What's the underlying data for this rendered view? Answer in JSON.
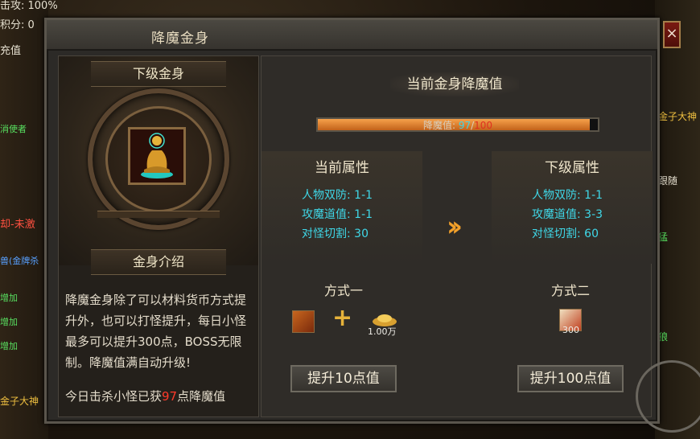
{
  "background": {
    "left_texts": [
      "击攻: 100%",
      "积分: 0",
      "充值",
      "消使者",
      "却-未激",
      "兽(金牌杀",
      "增加",
      "增加",
      "增加",
      "金子大神"
    ],
    "right_texts": [
      "金子大神",
      "跟随",
      "猛",
      "狼"
    ]
  },
  "window": {
    "title": "降魔金身",
    "close_label": "×"
  },
  "left": {
    "next_body_label": "下级金身",
    "intro_label": "金身介绍",
    "description": "降魔金身除了可以材料货币方式提升外，也可以打怪提升，每日小怪最多可以提升300点，BOSS无限制。降魔值满自动升级!",
    "today_prefix": "今日击杀小怪已获",
    "today_value": "97",
    "today_suffix": "点降魔值",
    "item_icon": "golden-buddha-statue-icon"
  },
  "right": {
    "title": "当前金身降魔值",
    "bar_label": "降魔值: ",
    "bar_current": "97",
    "bar_sep": "/",
    "bar_max": "100",
    "bar_fraction": 0.97,
    "current_attr": {
      "heading": "当前属性",
      "rows": [
        "人物双防: 1-1",
        "攻魔道值: 1-1",
        "对怪切割: 30"
      ]
    },
    "next_attr": {
      "heading": "下级属性",
      "rows": [
        "人物双防: 1-1",
        "攻魔道值: 3-3",
        "对怪切割: 60"
      ]
    },
    "method1": {
      "label": "方式一",
      "item_icon": "red-scroll-icon",
      "currency_icon": "gold-ingot-icon",
      "currency_amount": "1.00万",
      "button": "提升10点值"
    },
    "method2": {
      "label": "方式二",
      "item_icon": "scroll-icon",
      "item_amount": "300",
      "button": "提升100点值"
    },
    "arrow_icon": "double-chevron-right-icon"
  },
  "colors": {
    "accent_cyan": "#3fd8e8",
    "accent_red": "#e03020",
    "bar_orange": "#f6a14a",
    "text_cream": "#f0e6cc"
  }
}
